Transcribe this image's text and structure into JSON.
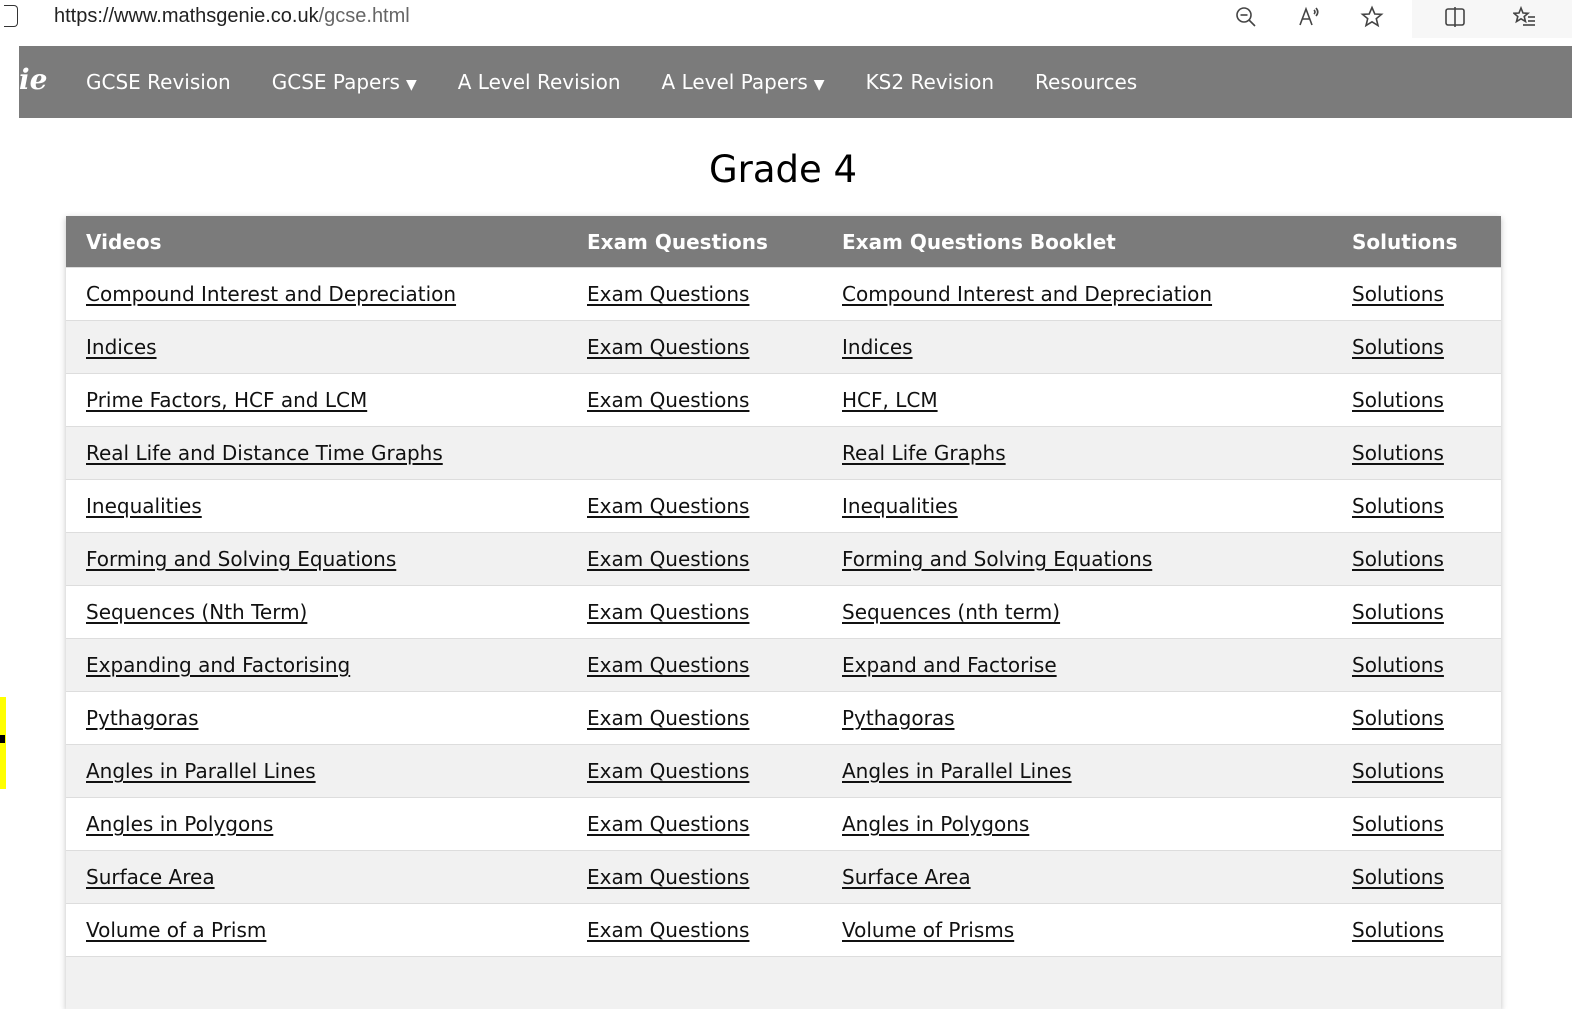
{
  "browser": {
    "url_host": "https://www.mathsgenie.co.uk",
    "url_path": "/gcse.html",
    "icons": [
      "zoom-out-icon",
      "read-aloud-icon",
      "favorite-star-icon",
      "split-screen-icon",
      "favorites-list-icon"
    ]
  },
  "nav": {
    "logo_fragment": "ie",
    "items": [
      {
        "label": "GCSE Revision",
        "dropdown": false
      },
      {
        "label": "GCSE Papers",
        "dropdown": true
      },
      {
        "label": "A Level Revision",
        "dropdown": false
      },
      {
        "label": "A Level Papers",
        "dropdown": true
      },
      {
        "label": "KS2 Revision",
        "dropdown": false
      },
      {
        "label": "Resources",
        "dropdown": false
      }
    ],
    "caret": "▼"
  },
  "page": {
    "title": "Grade 4"
  },
  "table": {
    "headers": [
      "Videos",
      "Exam Questions",
      "Exam Questions Booklet",
      "Solutions"
    ],
    "rows": [
      [
        "Compound Interest and Depreciation",
        "Exam Questions",
        "Compound Interest and Depreciation",
        "Solutions"
      ],
      [
        "Indices",
        "Exam Questions",
        "Indices",
        "Solutions"
      ],
      [
        "Prime Factors, HCF and LCM",
        "Exam Questions",
        "HCF, LCM",
        "Solutions"
      ],
      [
        "Real Life and Distance Time Graphs",
        "",
        "Real Life Graphs",
        "Solutions"
      ],
      [
        "Inequalities",
        "Exam Questions",
        "Inequalities",
        "Solutions"
      ],
      [
        "Forming and Solving Equations",
        "Exam Questions",
        "Forming and Solving Equations",
        "Solutions"
      ],
      [
        "Sequences (Nth Term)",
        "Exam Questions",
        "Sequences (nth term)",
        "Solutions"
      ],
      [
        "Expanding and Factorising",
        "Exam Questions",
        "Expand and Factorise",
        "Solutions"
      ],
      [
        "Pythagoras",
        "Exam Questions",
        "Pythagoras",
        "Solutions"
      ],
      [
        "Angles in Parallel Lines",
        "Exam Questions",
        "Angles in Parallel Lines",
        "Solutions"
      ],
      [
        "Angles in Polygons",
        "Exam Questions",
        "Angles in Polygons",
        "Solutions"
      ],
      [
        "Surface Area",
        "Exam Questions",
        "Surface Area",
        "Solutions"
      ],
      [
        "Volume of a Prism",
        "Exam Questions",
        "Volume of Prisms",
        "Solutions"
      ],
      [
        "",
        "",
        "",
        ""
      ]
    ]
  },
  "colors": {
    "nav_bg": "#7b7b7b",
    "header_bg": "#7b7b7b",
    "row_alt": "#f1f1f1",
    "edge_highlight": "#ffff00"
  }
}
